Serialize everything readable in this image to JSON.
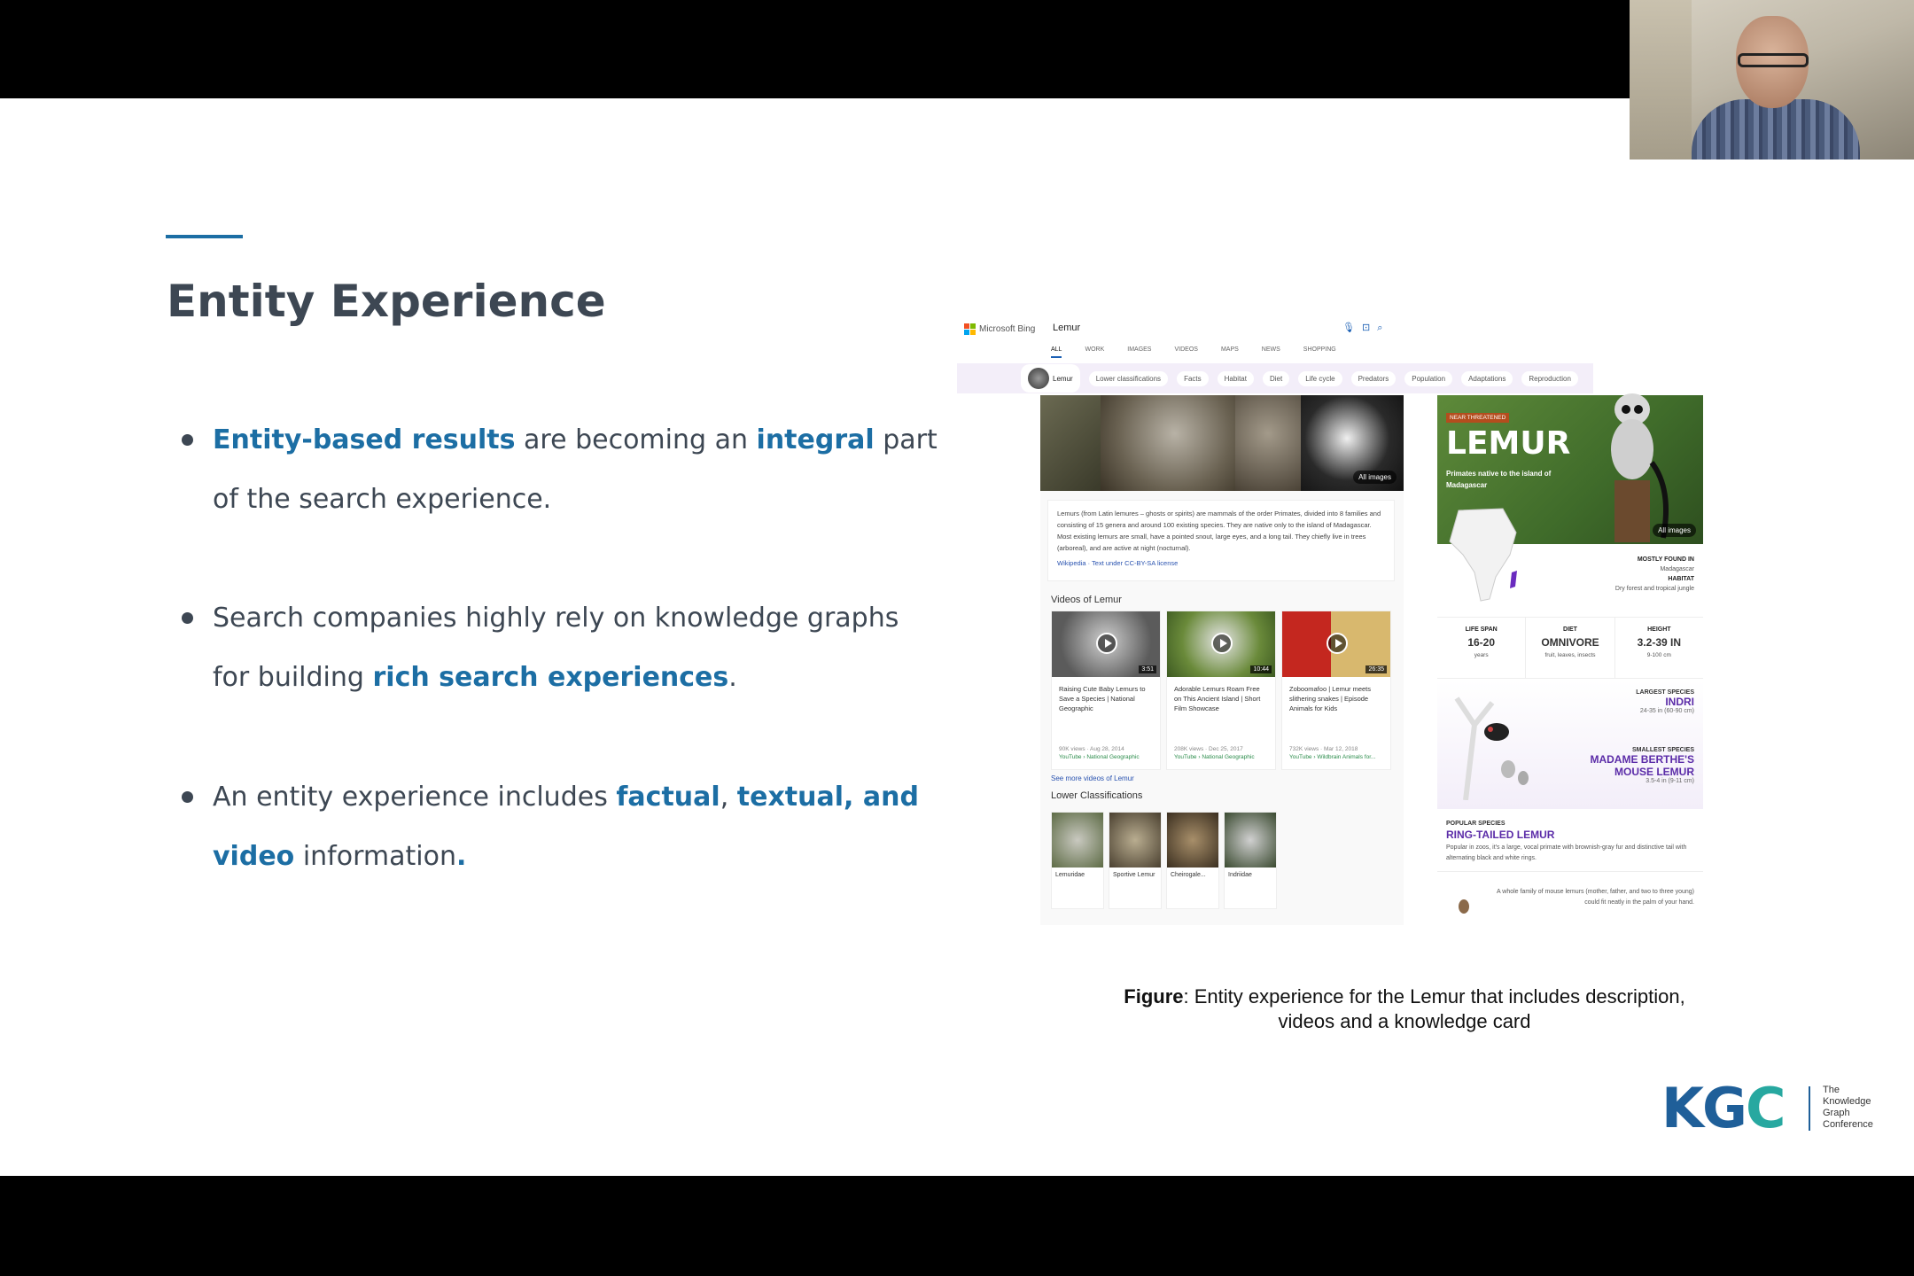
{
  "slide": {
    "title": "Entity Experience",
    "bullets": [
      {
        "parts": [
          {
            "text": "Entity-based results",
            "highlight": true
          },
          {
            "text": " are becoming an ",
            "highlight": false
          },
          {
            "text": "integral",
            "highlight": true
          },
          {
            "text": " part of the search experience.",
            "highlight": false
          }
        ]
      },
      {
        "parts": [
          {
            "text": "Search companies highly rely on knowledge graphs for building ",
            "highlight": false
          },
          {
            "text": "rich search experiences",
            "highlight": true
          },
          {
            "text": ".",
            "highlight": false
          }
        ]
      },
      {
        "parts": [
          {
            "text": "An entity experience includes ",
            "highlight": false
          },
          {
            "text": "factual",
            "highlight": true
          },
          {
            "text": ", ",
            "highlight": false
          },
          {
            "text": "textual, and video",
            "highlight": true
          },
          {
            "text": " information",
            "highlight": false
          },
          {
            "text": ".",
            "highlight": true
          }
        ]
      }
    ],
    "caption_bold": "Figure",
    "caption_rest": ": Entity experience for the Lemur that includes description, videos and a knowledge card",
    "logo": {
      "letters_a": "KG",
      "letters_b": "C",
      "line1": "The",
      "line2": "Knowledge",
      "line3": "Graph",
      "line4": "Conference"
    }
  },
  "bing": {
    "brand": "Microsoft Bing",
    "query": "Lemur",
    "tabs": [
      "ALL",
      "WORK",
      "IMAGES",
      "VIDEOS",
      "MAPS",
      "NEWS",
      "SHOPPING"
    ],
    "chips": [
      "Lemur",
      "Lower classifications",
      "Facts",
      "Habitat",
      "Diet",
      "Life cycle",
      "Predators",
      "Population",
      "Adaptations",
      "Reproduction"
    ],
    "all_images": "All images",
    "description": "Lemurs (from Latin lemures – ghosts or spirits) are mammals of the order Primates, divided into 8 families and consisting of 15 genera and around 100 existing species. They are native only to the island of Madagascar. Most existing lemurs are small, have a pointed snout, large eyes, and a long tail. They chiefly live in trees (arboreal), and are active at night (nocturnal).",
    "desc_source": "Wikipedia · Text under CC-BY-SA license",
    "videos_heading": "Videos of Lemur",
    "videos": [
      {
        "title": "Raising Cute Baby Lemurs to Save a Species | National Geographic",
        "duration": "3:51",
        "meta": "90K views · Aug 28, 2014",
        "source": "YouTube › National Geographic"
      },
      {
        "title": "Adorable Lemurs Roam Free on This Ancient Island | Short Film Showcase",
        "duration": "10:44",
        "meta": "208K views · Dec 25, 2017",
        "source": "YouTube › National Geographic"
      },
      {
        "title": "Zoboomafoo | Lemur meets slithering snakes | Episode Animals for Kids",
        "duration": "26:35",
        "meta": "732K views · Mar 12, 2018",
        "source": "YouTube › Wildbrain Animals for..."
      }
    ],
    "see_more": "See more videos of Lemur",
    "lower_heading": "Lower Classifications",
    "lower": [
      "Lemuridae",
      "Sportive Lemur",
      "Cheirogale...",
      "Indriidae"
    ],
    "card": {
      "badge": "NEAR THREATENED",
      "name": "LEMUR",
      "subtitle": "Primates native to the island of Madagascar",
      "found_label": "MOSTLY FOUND IN",
      "found_value": "Madagascar",
      "habitat_label": "HABITAT",
      "habitat_value": "Dry forest and tropical jungle",
      "stats": [
        {
          "label": "LIFE SPAN",
          "value": "16-20",
          "unit": "years"
        },
        {
          "label": "DIET",
          "value": "OMNIVORE",
          "unit": "fruit, leaves, insects"
        },
        {
          "label": "HEIGHT",
          "value": "3.2-39 IN",
          "unit": "9-100 cm"
        }
      ],
      "largest_label": "LARGEST SPECIES",
      "largest_name": "INDRI",
      "largest_size": "24-35 in (60-90 cm)",
      "smallest_label": "SMALLEST SPECIES",
      "smallest_name": "MADAME BERTHE'S MOUSE LEMUR",
      "smallest_size": "3.5-4 in (9-11 cm)",
      "popular_label": "POPULAR SPECIES",
      "popular_name": "RING-TAILED LEMUR",
      "popular_desc": "Popular in zoos, it's a large, vocal primate with brownish-gray fur and distinctive tail with alternating black and white rings.",
      "fact": "A whole family of mouse lemurs (mother, father, and two to three young) could fit neatly in the palm of your hand."
    }
  }
}
